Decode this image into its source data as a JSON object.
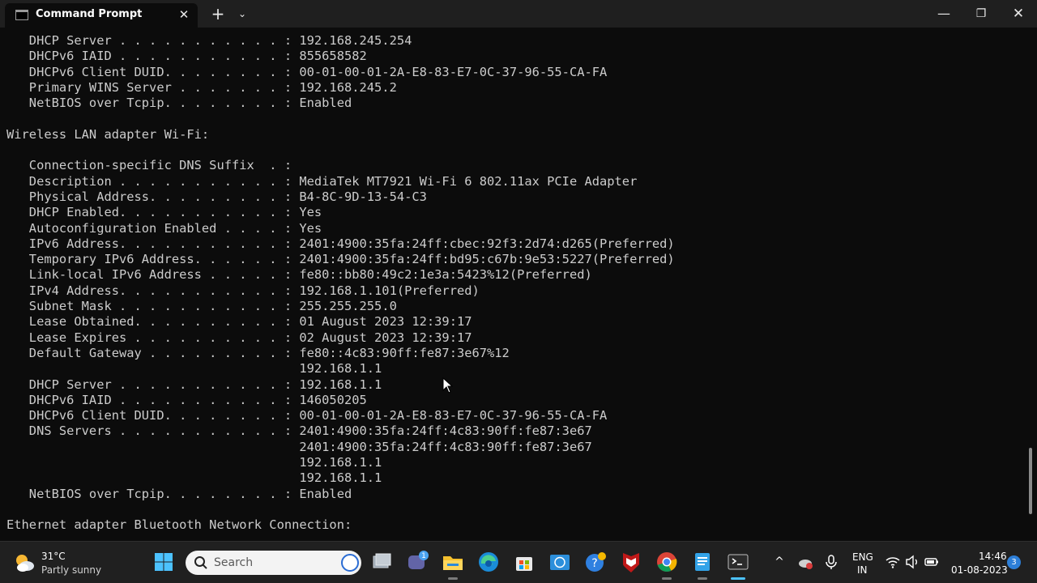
{
  "window": {
    "tab_title": "Command Prompt",
    "tab_close": "✕",
    "new_tab": "+",
    "tab_menu": "⌄",
    "minimize": "—",
    "maximize": "❐",
    "close": "✕"
  },
  "console": {
    "lines": [
      "   DHCP Server . . . . . . . . . . . : 192.168.245.254",
      "   DHCPv6 IAID . . . . . . . . . . . : 855658582",
      "   DHCPv6 Client DUID. . . . . . . . : 00-01-00-01-2A-E8-83-E7-0C-37-96-55-CA-FA",
      "   Primary WINS Server . . . . . . . : 192.168.245.2",
      "   NetBIOS over Tcpip. . . . . . . . : Enabled",
      "",
      "Wireless LAN adapter Wi-Fi:",
      "",
      "   Connection-specific DNS Suffix  . :",
      "   Description . . . . . . . . . . . : MediaTek MT7921 Wi-Fi 6 802.11ax PCIe Adapter",
      "   Physical Address. . . . . . . . . : B4-8C-9D-13-54-C3",
      "   DHCP Enabled. . . . . . . . . . . : Yes",
      "   Autoconfiguration Enabled . . . . : Yes",
      "   IPv6 Address. . . . . . . . . . . : 2401:4900:35fa:24ff:cbec:92f3:2d74:d265(Preferred)",
      "   Temporary IPv6 Address. . . . . . : 2401:4900:35fa:24ff:bd95:c67b:9e53:5227(Preferred)",
      "   Link-local IPv6 Address . . . . . : fe80::bb80:49c2:1e3a:5423%12(Preferred)",
      "   IPv4 Address. . . . . . . . . . . : 192.168.1.101(Preferred)",
      "   Subnet Mask . . . . . . . . . . . : 255.255.255.0",
      "   Lease Obtained. . . . . . . . . . : 01 August 2023 12:39:17",
      "   Lease Expires . . . . . . . . . . : 02 August 2023 12:39:17",
      "   Default Gateway . . . . . . . . . : fe80::4c83:90ff:fe87:3e67%12",
      "                                       192.168.1.1",
      "   DHCP Server . . . . . . . . . . . : 192.168.1.1",
      "   DHCPv6 IAID . . . . . . . . . . . : 146050205",
      "   DHCPv6 Client DUID. . . . . . . . : 00-01-00-01-2A-E8-83-E7-0C-37-96-55-CA-FA",
      "   DNS Servers . . . . . . . . . . . : 2401:4900:35fa:24ff:4c83:90ff:fe87:3e67",
      "                                       2401:4900:35fa:24ff:4c83:90ff:fe87:3e67",
      "                                       192.168.1.1",
      "                                       192.168.1.1",
      "   NetBIOS over Tcpip. . . . . . . . : Enabled",
      "",
      "Ethernet adapter Bluetooth Network Connection:"
    ]
  },
  "taskbar": {
    "weather_temp": "31°C",
    "weather_desc": "Partly sunny",
    "search_placeholder": "Search",
    "language_line1": "ENG",
    "language_line2": "IN",
    "time": "14:46",
    "date": "01-08-2023",
    "notification_count": "3",
    "teams_badge": "1",
    "tray_overflow": "^"
  },
  "colors": {
    "console_bg": "#0c0c0c",
    "console_text": "#cccccc",
    "titlebar_bg": "#1f1f1f",
    "taskbar_bg": "#202020",
    "accent": "#4cc2ff"
  }
}
